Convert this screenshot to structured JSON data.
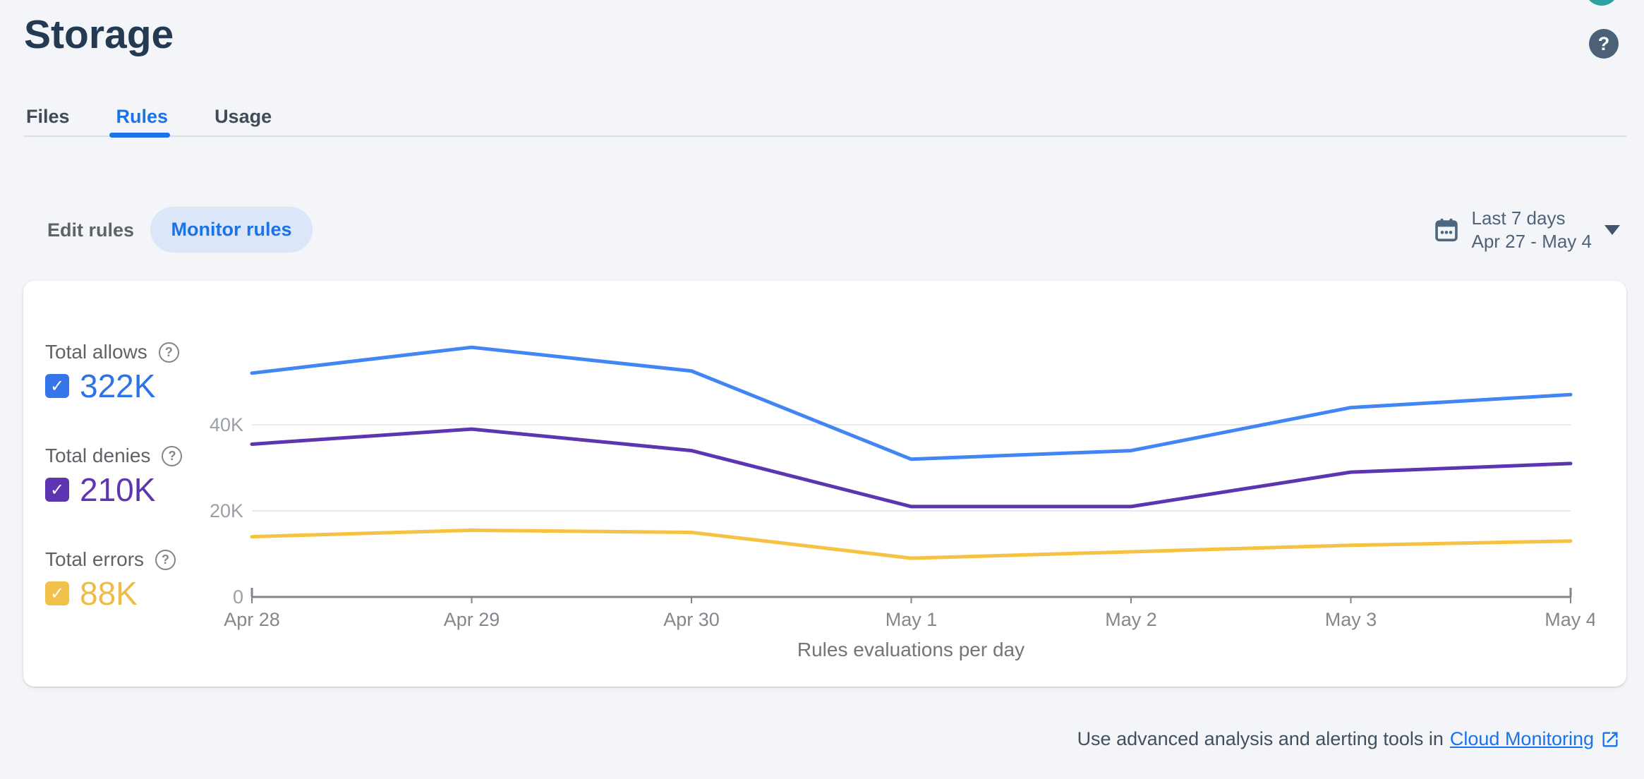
{
  "page": {
    "title": "Storage"
  },
  "header": {
    "help_icon": "question-mark-circle",
    "avatar_icon": "account-avatar-partial"
  },
  "tabs": [
    {
      "label": "Files",
      "active": false
    },
    {
      "label": "Rules",
      "active": true
    },
    {
      "label": "Usage",
      "active": false
    }
  ],
  "toolbar": {
    "edit_rules_label": "Edit rules",
    "monitor_rules_label": "Monitor rules"
  },
  "date_range": {
    "icon": "calendar",
    "preset": "Last 7 days",
    "range": "Apr 27 - May 4",
    "dropdown_icon": "triangle-down"
  },
  "legend": {
    "items": [
      {
        "label": "Total allows",
        "value": "322K",
        "checked": true,
        "checkbox_color": "#3476e8",
        "value_color": "#2b74e8",
        "help_icon": "question-mark-outline"
      },
      {
        "label": "Total denies",
        "value": "210K",
        "checked": true,
        "checkbox_color": "#5e35b1",
        "value_color": "#5e35b1",
        "help_icon": "question-mark-outline"
      },
      {
        "label": "Total errors",
        "value": "88K",
        "checked": true,
        "checkbox_color": "#f2c14b",
        "value_color": "#eebb45",
        "help_icon": "question-mark-outline"
      }
    ]
  },
  "chart_data": {
    "type": "line",
    "title": "Rules evaluations per day",
    "categories": [
      "Apr 28",
      "Apr 29",
      "Apr 30",
      "May 1",
      "May 2",
      "May 3",
      "May 4"
    ],
    "series": [
      {
        "name": "Total allows",
        "color": "#4285f4",
        "values": [
          52000,
          58000,
          52500,
          32000,
          34000,
          44000,
          47000
        ]
      },
      {
        "name": "Total denies",
        "color": "#5e35b1",
        "values": [
          35500,
          39000,
          34000,
          21000,
          21000,
          29000,
          31000
        ]
      },
      {
        "name": "Total errors",
        "color": "#f6c244",
        "values": [
          14000,
          15500,
          15000,
          9000,
          10500,
          12000,
          13000
        ]
      }
    ],
    "ylim": [
      0,
      60000
    ],
    "yticks": [
      {
        "value": 0,
        "label": "0"
      },
      {
        "value": 20000,
        "label": "20K"
      },
      {
        "value": 40000,
        "label": "40K"
      }
    ],
    "grid": "horizontal",
    "legend_position": "left"
  },
  "footer": {
    "text": "Use advanced analysis and alerting tools in",
    "link_label": "Cloud Monitoring",
    "icon": "open-in-new"
  }
}
